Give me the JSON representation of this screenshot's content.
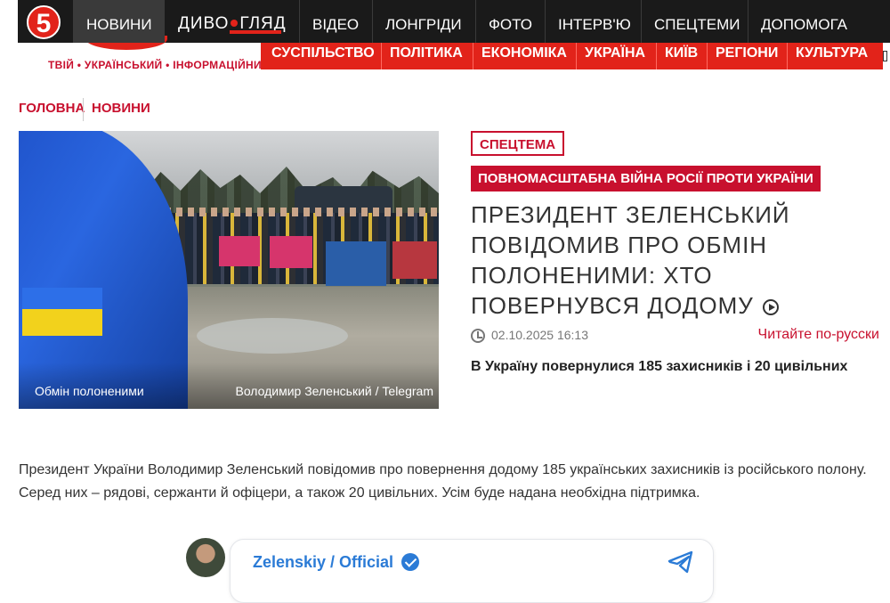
{
  "brand": {
    "logo_text": "5",
    "slogan": "ТВІЙ • УКРАЇНСЬКИЙ • ІНФОРМАЦІЙНИЙ",
    "accent_color": "#e2231a"
  },
  "top_nav": {
    "items": [
      "НОВИНИ",
      "ВІДЕО",
      "ЛОНГРІДИ",
      "ФОТО",
      "ІНТЕРВ'Ю",
      "СПЕЦТЕМИ",
      "ДОПОМОГА"
    ],
    "divohliad_left": "ДИВО",
    "divohliad_right": "ГЛЯД"
  },
  "sub_nav": {
    "items": [
      "СУСПІЛЬСТВО",
      "ПОЛІТИКА",
      "ЕКОНОМІКА",
      "УКРАЇНА",
      "КИЇВ",
      "РЕГІОНИ",
      "КУЛЬТУРА"
    ]
  },
  "breadcrumb": {
    "home": "ГОЛОВНА",
    "section": "НОВИНИ"
  },
  "photo": {
    "caption": "Обмін полоненими",
    "credit": "Володимир Зеленський / Telegram"
  },
  "article": {
    "special_tag": "СПЕЦТЕМА",
    "topic_tag": "ПОВНОМАСШТАБНА ВІЙНА РОСІЇ ПРОТИ УКРАЇНИ",
    "headline": "ПРЕЗИДЕНТ ЗЕЛЕНСЬКИЙ ПОВІДОМИВ ПРО ОБМІН ПОЛОНЕНИМИ: ХТО ПОВЕРНУВСЯ ДОДОМУ",
    "date": "02.10.2025 16:13",
    "read_in_russian": "Читайте по-русски",
    "lead": "В Україну повернулися 185 захисників і 20 цивільних",
    "body": "Президент України Володимир Зеленський повідомив про повернення додому 185 українських захисників із російського полону. Серед них – рядові, сержанти й офіцери, а також 20 цивільних. Усім буде надана необхідна підтримка."
  },
  "telegram": {
    "channel_name": "Zelenskiy / Official",
    "icon": "telegram-icon",
    "verified_icon": "verified-icon"
  }
}
